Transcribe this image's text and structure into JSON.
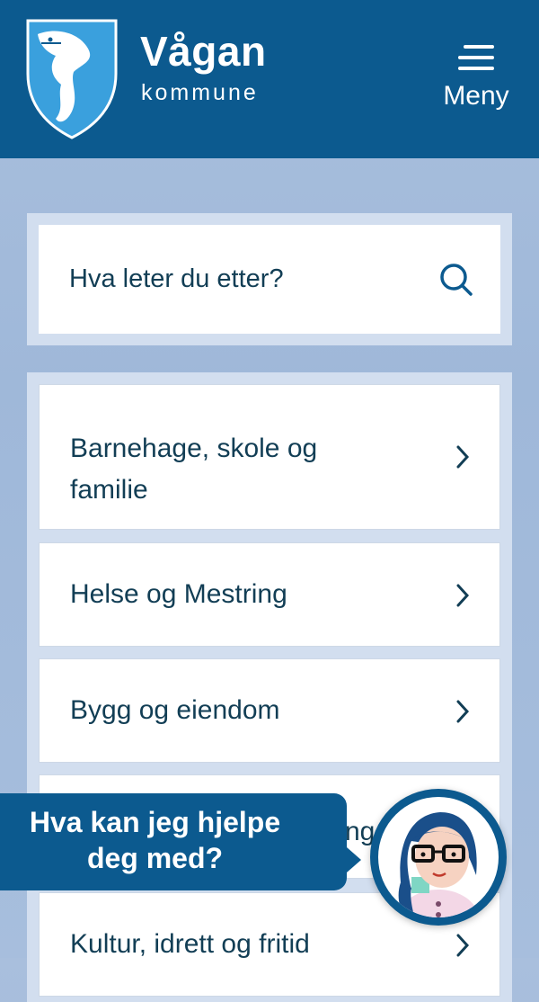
{
  "header": {
    "brand_title": "Vågan",
    "brand_sub": "kommune",
    "menu_label": "Meny"
  },
  "search": {
    "placeholder": "Hva leter du etter?"
  },
  "nav": {
    "items": [
      {
        "label_line1": "Barnehage, skole og",
        "label_line2": "familie"
      },
      {
        "label": "Helse og Mestring"
      },
      {
        "label": "Bygg og eiendom"
      },
      {
        "label_visible_fragment": "ng"
      },
      {
        "label": "Kultur, idrett og fritid"
      }
    ]
  },
  "chat": {
    "line1": "Hva kan jeg hjelpe",
    "line2": "deg med?"
  },
  "colors": {
    "header_bg": "#0c5a8f",
    "text_dark": "#123e55",
    "panel_bg": "#d2deef"
  }
}
